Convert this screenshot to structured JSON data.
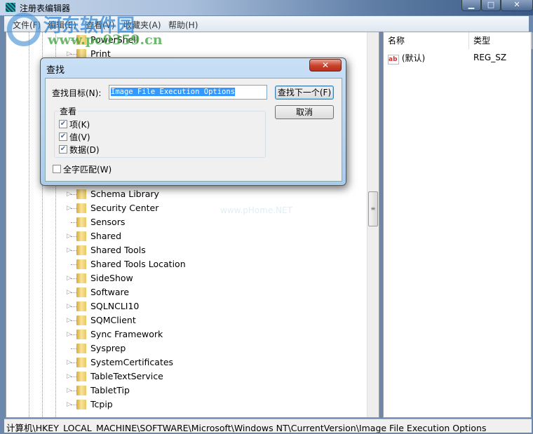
{
  "window": {
    "title": "注册表编辑器",
    "min": "▁",
    "max": "□",
    "close": "✕"
  },
  "menu": [
    "文件(F)",
    "编辑(E)",
    "查看(V)",
    "收藏夹(A)",
    "帮助(H)"
  ],
  "tree_top": [
    "PowerShell",
    "Print"
  ],
  "tree_bottom": [
    {
      "label": "Schema Library",
      "expandable": true
    },
    {
      "label": "Security Center",
      "expandable": true
    },
    {
      "label": "Sensors",
      "expandable": false
    },
    {
      "label": "Shared",
      "expandable": true
    },
    {
      "label": "Shared Tools",
      "expandable": true
    },
    {
      "label": "Shared Tools Location",
      "expandable": false
    },
    {
      "label": "SideShow",
      "expandable": true
    },
    {
      "label": "Software",
      "expandable": true
    },
    {
      "label": "SQLNCLI10",
      "expandable": true
    },
    {
      "label": "SQMClient",
      "expandable": true
    },
    {
      "label": "Sync Framework",
      "expandable": true
    },
    {
      "label": "Sysprep",
      "expandable": false
    },
    {
      "label": "SystemCertificates",
      "expandable": true
    },
    {
      "label": "TableTextService",
      "expandable": true
    },
    {
      "label": "TabletTip",
      "expandable": true
    },
    {
      "label": "Tcpip",
      "expandable": true
    }
  ],
  "list": {
    "headers": [
      "名称",
      "类型"
    ],
    "rows": [
      {
        "name": "(默认)",
        "type": "REG_SZ",
        "icon": "ab"
      }
    ]
  },
  "status": "计算机\\HKEY_LOCAL_MACHINE\\SOFTWARE\\Microsoft\\Windows NT\\CurrentVersion\\Image File Execution Options",
  "dialog": {
    "title": "查找",
    "close": "✕",
    "find_label": "查找目标(N):",
    "find_value": "Image File Execution Options",
    "find_next": "查找下一个(F)",
    "cancel": "取消",
    "look_at": "查看",
    "options": [
      {
        "label": "项(K)",
        "checked": true
      },
      {
        "label": "值(V)",
        "checked": true
      },
      {
        "label": "数据(D)",
        "checked": true
      }
    ],
    "whole_word": {
      "label": "全字匹配(W)",
      "checked": false
    }
  },
  "watermark": {
    "logo": "河东软件园",
    "url": "www.pc0359.cn",
    "url2": "www.pHome.NET"
  }
}
